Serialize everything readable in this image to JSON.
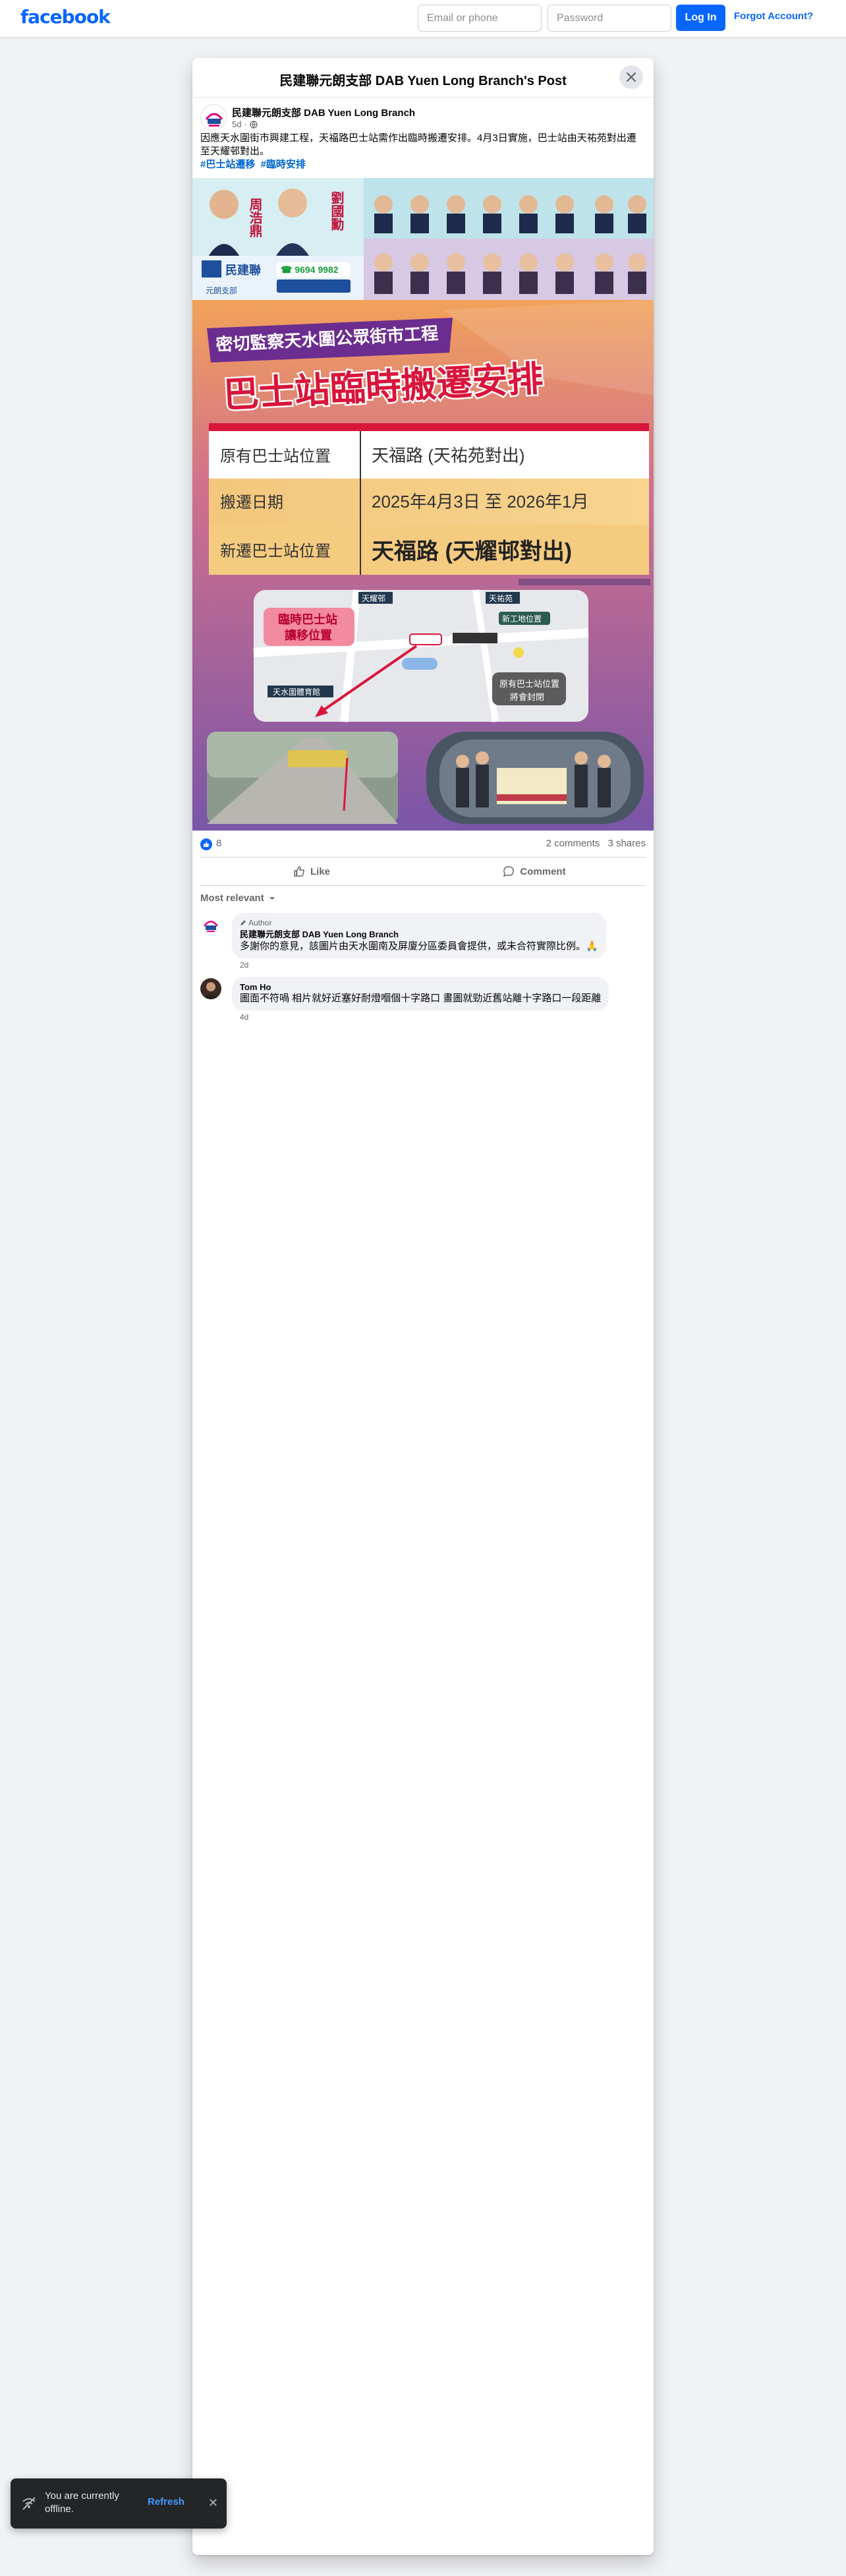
{
  "header": {
    "logo": "facebook",
    "email_placeholder": "Email or phone",
    "password_placeholder": "Password",
    "login_label": "Log In",
    "forgot_label": "Forgot Account?"
  },
  "modal": {
    "title": "民建聯元朗支部 DAB Yuen Long Branch's Post"
  },
  "post": {
    "author": "民建聯元朗支部 DAB Yuen Long Branch",
    "time": "5d",
    "text": "因應天水圍街市興建工程，天福路巴士站需作出臨時搬遷安排。4月3日實施，巴士站由天祐苑對出遷至天耀邨對出。",
    "hashtags": [
      "#巴士站遷移",
      "#臨時安排"
    ],
    "image": {
      "header_name_1": "周浩鼎",
      "header_name_2": "劉國勳",
      "phone": "9694 9982",
      "party": "民建聯",
      "branch": "元朗支部",
      "banner_sub": "密切監察天水圍公眾街市工程",
      "banner_main": "巴士站臨時搬遷安排",
      "rows": [
        {
          "label": "原有巴士站位置",
          "value": "天福路 (天祐苑對出)"
        },
        {
          "label": "搬遷日期",
          "value": "2025年4月3日 至 2026年1月"
        },
        {
          "label": "新遷巴士站位置",
          "value": "天福路 (天耀邨對出)"
        }
      ],
      "map_label_temp": "臨時巴士站\n讓移位置",
      "map_label_old": "原有巴士站位置\n將會封閉",
      "map_tag_1": "天耀邨",
      "map_tag_2": "天祐苑",
      "map_tag_3": "新工地位置",
      "map_tag_4": "天水圍體育館"
    },
    "reactions_count": "8",
    "comments_count": "2 comments",
    "shares_count": "3 shares",
    "like_label": "Like",
    "comment_label": "Comment",
    "sort_label": "Most relevant"
  },
  "comments": [
    {
      "badge": "Author",
      "name": "民建聯元朗支部 DAB Yuen Long Branch",
      "text": "多謝你的意見，該圖片由天水圍南及屏廈分區委員會提供，或未合符實際比例。🙏",
      "time": "2d"
    },
    {
      "name": "Tom Ho",
      "text": "圖面不符喎 相片就好近塞好耐燈嗰個十字路口 畫圖就勁近舊站離十字路口一段距離",
      "time": "4d"
    }
  ],
  "toast": {
    "text": "You are currently offline.",
    "refresh": "Refresh"
  },
  "colors": {
    "brand": "#0866ff",
    "background": "#f0f2f5",
    "toast": "#242526"
  }
}
